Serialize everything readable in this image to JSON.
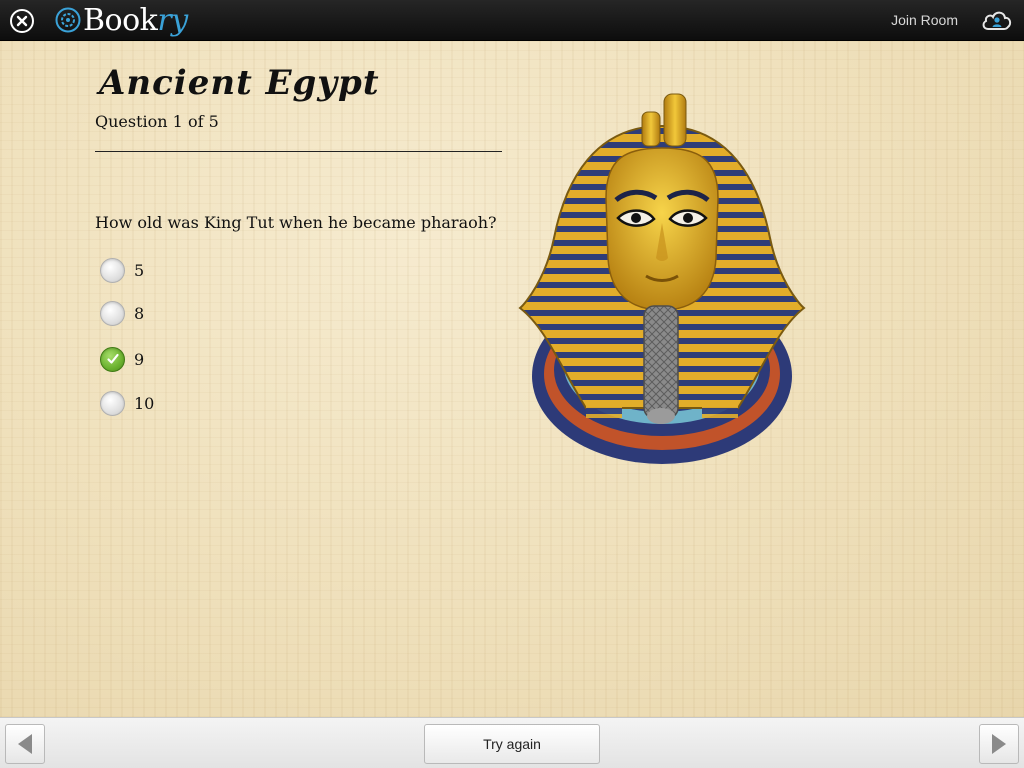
{
  "app": {
    "logo_prefix": "Book",
    "logo_suffix": "ry",
    "join_room_label": "Join Room"
  },
  "quiz": {
    "title": "Ancient Egypt",
    "progress": "Question 1 of 5",
    "question": "How old was King Tut when he became pharaoh?",
    "options": [
      {
        "label": "5",
        "selected": false
      },
      {
        "label": "8",
        "selected": false
      },
      {
        "label": "9",
        "selected": true
      },
      {
        "label": "10",
        "selected": false
      }
    ]
  },
  "footer": {
    "try_again_label": "Try again"
  },
  "colors": {
    "topbar": "#111111",
    "accent_blue": "#3aa2d8",
    "check_green": "#6bb22f",
    "papyrus": "#f1e4c3"
  },
  "icons": {
    "close": "close-icon",
    "logo": "gear-logo-icon",
    "cloud": "cloud-user-icon",
    "prev": "arrow-left-icon",
    "next": "arrow-right-icon",
    "check": "checkmark-icon"
  }
}
